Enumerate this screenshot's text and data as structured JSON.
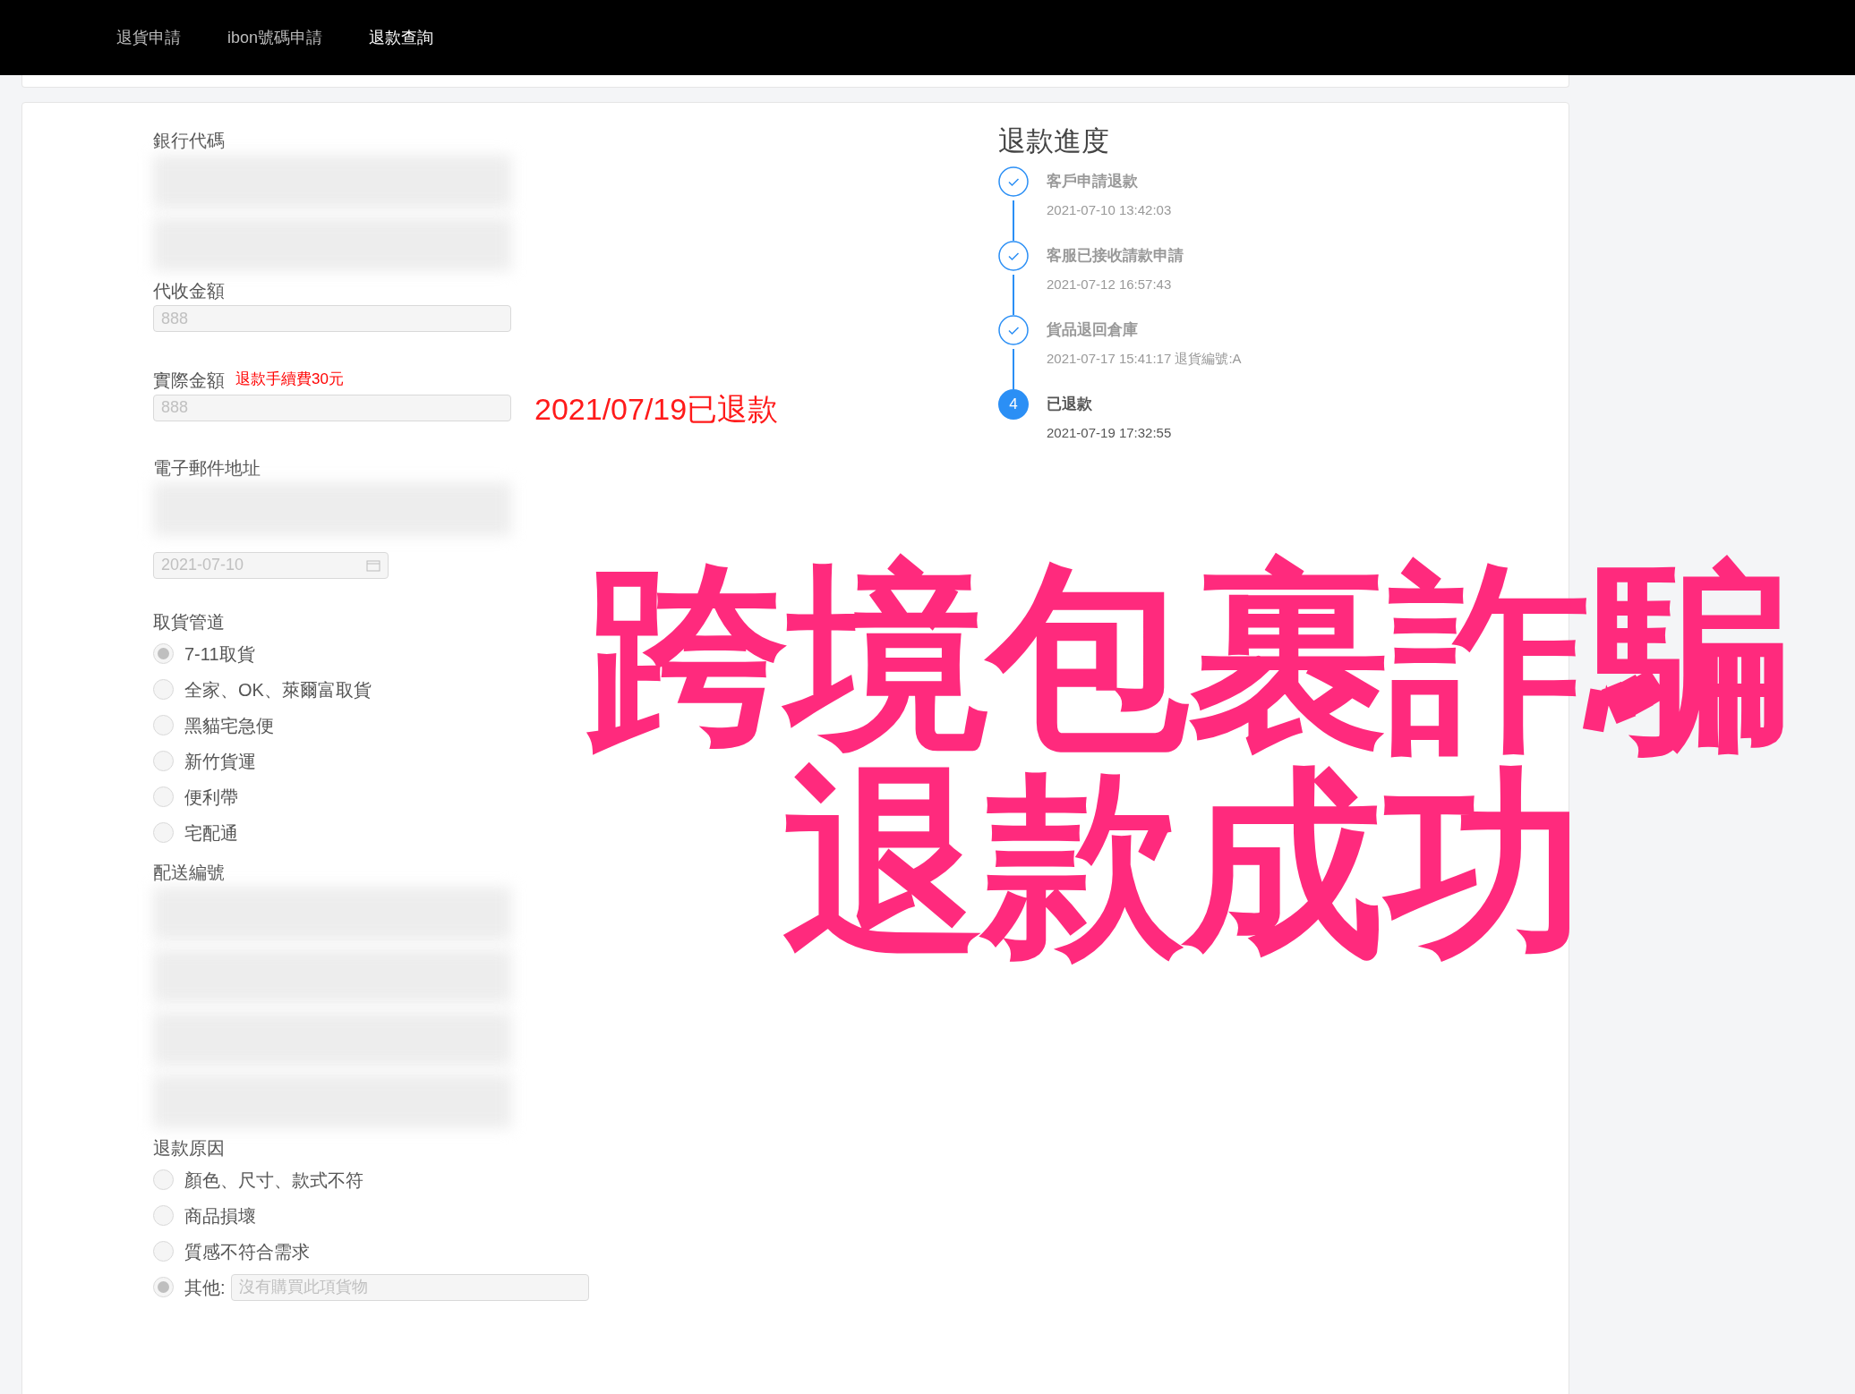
{
  "nav": [
    {
      "label": "退貨申請",
      "selected": false
    },
    {
      "label": "ibon號碼申請",
      "selected": false
    },
    {
      "label": "退款查詢",
      "selected": true
    }
  ],
  "form": [
    {
      "kind": "label",
      "label": "銀行代碼"
    },
    {
      "kind": "redacted"
    },
    {
      "kind": "redacted"
    },
    {
      "kind": "field",
      "label": "代收金額",
      "value": "888"
    },
    {
      "kind": "field",
      "label": "實際金額",
      "note": "退款手續費30元",
      "value": "888"
    },
    {
      "kind": "label",
      "label": "電子郵件地址"
    },
    {
      "kind": "redacted"
    },
    {
      "kind": "date",
      "value": "2021-07-10"
    },
    {
      "kind": "radios",
      "label": "取貨管道",
      "options": [
        {
          "label": "7-11取貨",
          "selected": true
        },
        {
          "label": "全家、OK、萊爾富取貨",
          "selected": false
        },
        {
          "label": "黑貓宅急便",
          "selected": false
        },
        {
          "label": "新竹貨運",
          "selected": false
        },
        {
          "label": "便利帶",
          "selected": false
        },
        {
          "label": "宅配通",
          "selected": false
        }
      ]
    },
    {
      "kind": "label",
      "label": "配送編號"
    },
    {
      "kind": "redacted"
    },
    {
      "kind": "redacted"
    },
    {
      "kind": "redacted"
    },
    {
      "kind": "redacted"
    },
    {
      "kind": "radios",
      "label": "退款原因",
      "options": [
        {
          "label": "顏色、尺寸、款式不符",
          "selected": false
        },
        {
          "label": "商品損壞",
          "selected": false
        },
        {
          "label": "質感不符合需求",
          "selected": false
        },
        {
          "label": "其他:",
          "selected": true,
          "placeholder": "沒有購買此項貨物"
        }
      ]
    }
  ],
  "note": "2021/07/19已退款",
  "progress": {
    "title": "退款進度",
    "steps": [
      {
        "done": true,
        "title": "客戶申請退款",
        "time": "2021-07-10 13:42:03"
      },
      {
        "done": true,
        "title": "客服已接收請款申請",
        "time": "2021-07-12 16:57:43"
      },
      {
        "done": true,
        "title": "貨品退回倉庫",
        "time": "2021-07-17 15:41:17 退貨編號:A"
      },
      {
        "done": false,
        "number": "4",
        "title": "已退款",
        "time": "2021-07-19 17:32:55"
      }
    ]
  },
  "headline": [
    "跨境包裹詐騙",
    "退款成功"
  ]
}
